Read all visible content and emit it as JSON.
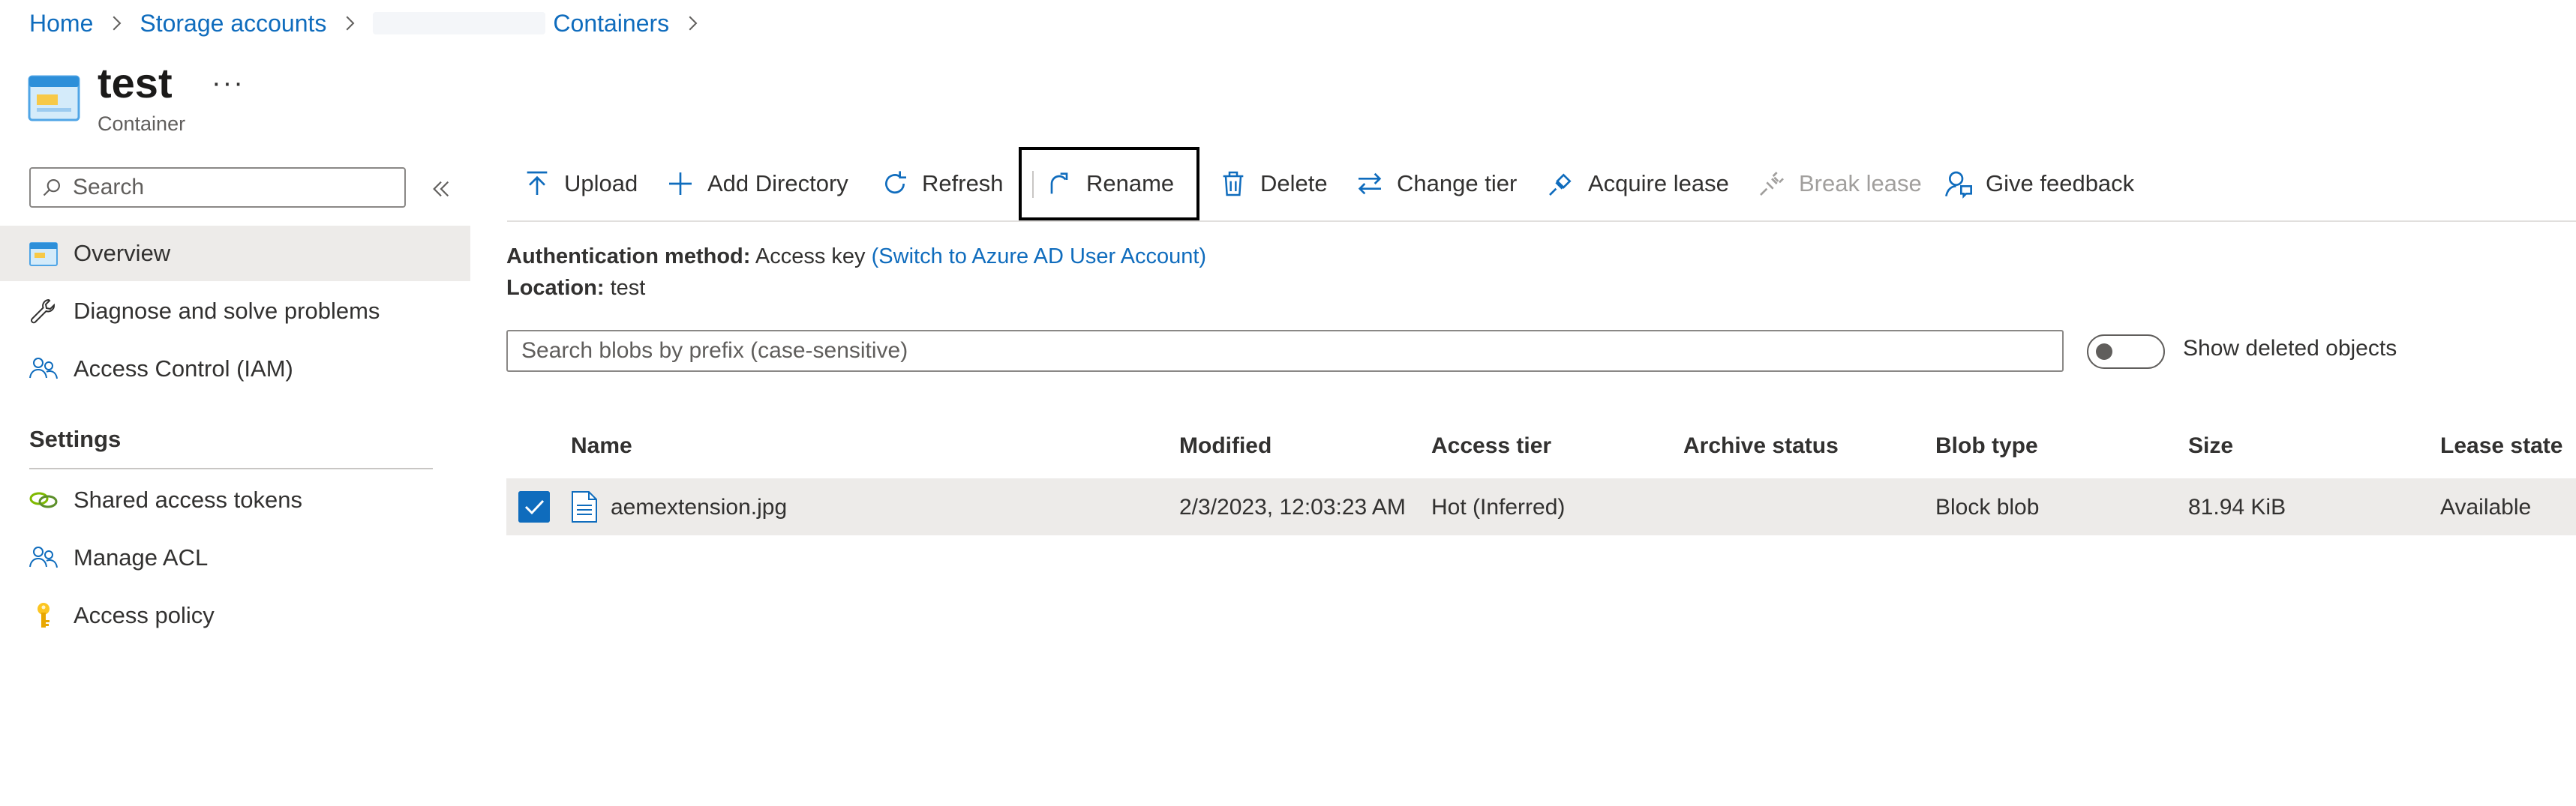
{
  "breadcrumb": {
    "items": [
      "Home",
      "Storage accounts",
      "Containers"
    ]
  },
  "header": {
    "title": "test",
    "more": "···",
    "subtitle": "Container"
  },
  "sidebar": {
    "search_placeholder": "Search",
    "items": [
      {
        "label": "Overview",
        "icon": "container-icon"
      },
      {
        "label": "Diagnose and solve problems",
        "icon": "wrench-icon"
      },
      {
        "label": "Access Control (IAM)",
        "icon": "people-icon"
      }
    ],
    "settings_header": "Settings",
    "settings_items": [
      {
        "label": "Shared access tokens",
        "icon": "link-icon"
      },
      {
        "label": "Manage ACL",
        "icon": "people-icon"
      },
      {
        "label": "Access policy",
        "icon": "key-icon"
      }
    ]
  },
  "toolbar": {
    "upload": "Upload",
    "add_directory": "Add Directory",
    "refresh": "Refresh",
    "rename": "Rename",
    "delete": "Delete",
    "change_tier": "Change tier",
    "acquire_lease": "Acquire lease",
    "break_lease": "Break lease",
    "give_feedback": "Give feedback"
  },
  "info": {
    "auth_label": "Authentication method:",
    "auth_value": "Access key",
    "auth_link": "(Switch to Azure AD User Account)",
    "location_label": "Location:",
    "location_value": "test"
  },
  "blob_search": {
    "placeholder": "Search blobs by prefix (case-sensitive)"
  },
  "show_deleted": {
    "label": "Show deleted objects",
    "on": false
  },
  "table": {
    "columns": [
      "Name",
      "Modified",
      "Access tier",
      "Archive status",
      "Blob type",
      "Size",
      "Lease state"
    ],
    "rows": [
      {
        "name": "aemextension.jpg",
        "modified": "2/3/2023, 12:03:23 AM",
        "access_tier": "Hot (Inferred)",
        "archive_status": "",
        "blob_type": "Block blob",
        "size": "81.94 KiB",
        "lease_state": "Available",
        "selected": true
      }
    ]
  },
  "colors": {
    "accent": "#0f6cbd",
    "selected_row": "#edebe9",
    "text": "#323130",
    "disabled": "#a19f9d"
  }
}
